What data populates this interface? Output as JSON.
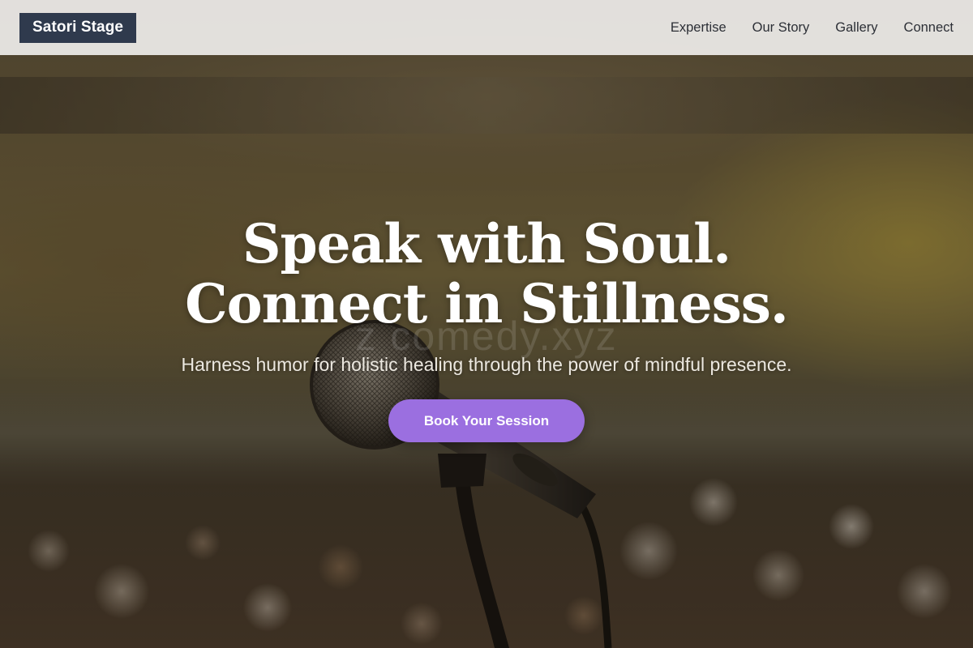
{
  "nav": {
    "brand": "Satori Stage",
    "links": [
      {
        "label": "Expertise"
      },
      {
        "label": "Our Story"
      },
      {
        "label": "Gallery"
      },
      {
        "label": "Connect"
      }
    ]
  },
  "hero": {
    "title_line1": "Speak with Soul.",
    "title_line2": "Connect in Stillness.",
    "subtitle": "Harness humor for holistic healing through the power of mindful presence.",
    "cta_label": "Book Your Session",
    "watermark": "z comedy.xyz"
  },
  "colors": {
    "brand_bg": "#2f3a4d",
    "cta": "#9b6fe0",
    "nav_bg": "#eeece9"
  }
}
